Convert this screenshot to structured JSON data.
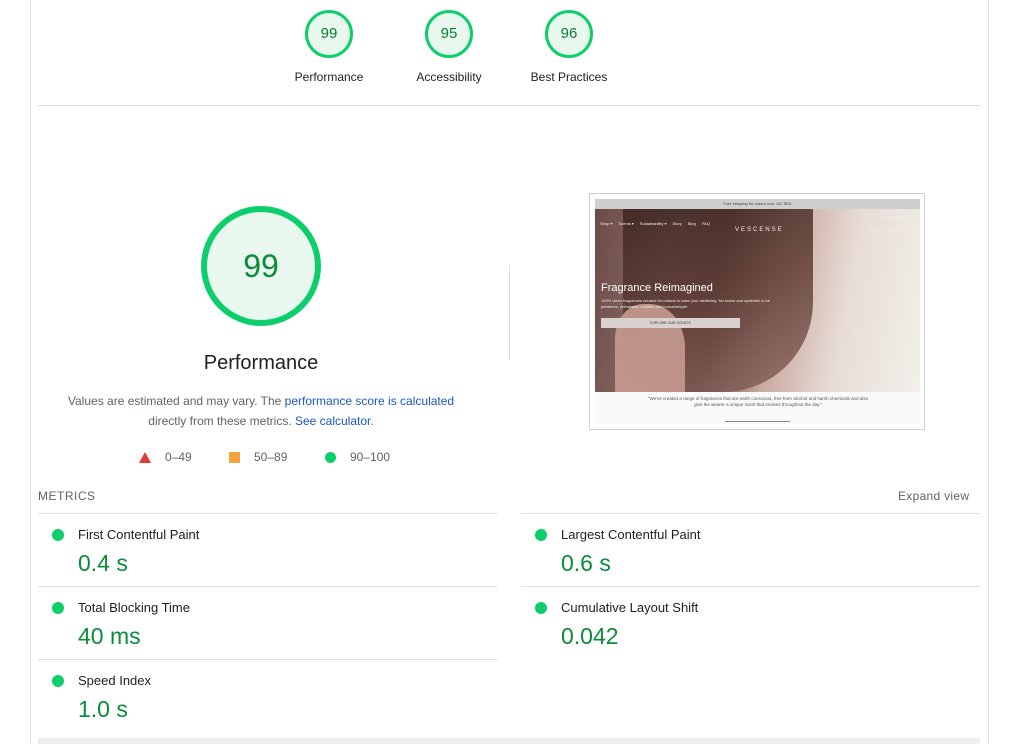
{
  "top_gauges": [
    {
      "score": "99",
      "label": "Performance"
    },
    {
      "score": "95",
      "label": "Accessibility"
    },
    {
      "score": "96",
      "label": "Best Practices"
    }
  ],
  "performance": {
    "score": "99",
    "title": "Performance",
    "desc_part1": "Values are estimated and may vary. The ",
    "desc_link1": "performance score is calculated",
    "desc_part2": " directly from these metrics. ",
    "desc_link2": "See calculator",
    "desc_part3": "."
  },
  "legend": [
    {
      "shape": "triangle",
      "range": "0–49",
      "color": "#e53935"
    },
    {
      "shape": "square",
      "range": "50–89",
      "color": "#f4a53a"
    },
    {
      "shape": "circle",
      "range": "90–100",
      "color": "#0cce6b"
    }
  ],
  "thumbnail": {
    "banner": "Free shipping for orders over 100 SEK",
    "logo": "VESCENSE",
    "nav_left": [
      "Shop ▾",
      "Scents ▾",
      "Sustainability ▾",
      "Story",
      "Blog",
      "FAQ"
    ],
    "nav_right": [
      "Contact",
      "Account",
      "Cart"
    ],
    "currency": "Sweden (SEK kr) ▾",
    "headline": "Fragrance Reimagined",
    "subtext": "100% clean fragrances created for natural to raise your wellbeing. No toxins and synthetic to be parabens, phthalates, sulfates and formaldehyde",
    "button": "EXPLORE OUR SCENTS",
    "quote": "\"We've created a range of fragrances that are earth conscious, free from alcohol and harsh chemicals and also give the wearer a unique scent that evolves throughout the day.\""
  },
  "metrics": {
    "header": "METRICS",
    "expand": "Expand view",
    "items": [
      {
        "title": "First Contentful Paint",
        "value": "0.4 s",
        "status": "good"
      },
      {
        "title": "Largest Contentful Paint",
        "value": "0.6 s",
        "status": "good"
      },
      {
        "title": "Total Blocking Time",
        "value": "40 ms",
        "status": "good"
      },
      {
        "title": "Cumulative Layout Shift",
        "value": "0.042",
        "status": "good"
      },
      {
        "title": "Speed Index",
        "value": "1.0 s",
        "status": "good"
      }
    ]
  },
  "colors": {
    "good": "#0cce6b",
    "good_text": "#0a8c39",
    "link": "#1a56c5"
  }
}
